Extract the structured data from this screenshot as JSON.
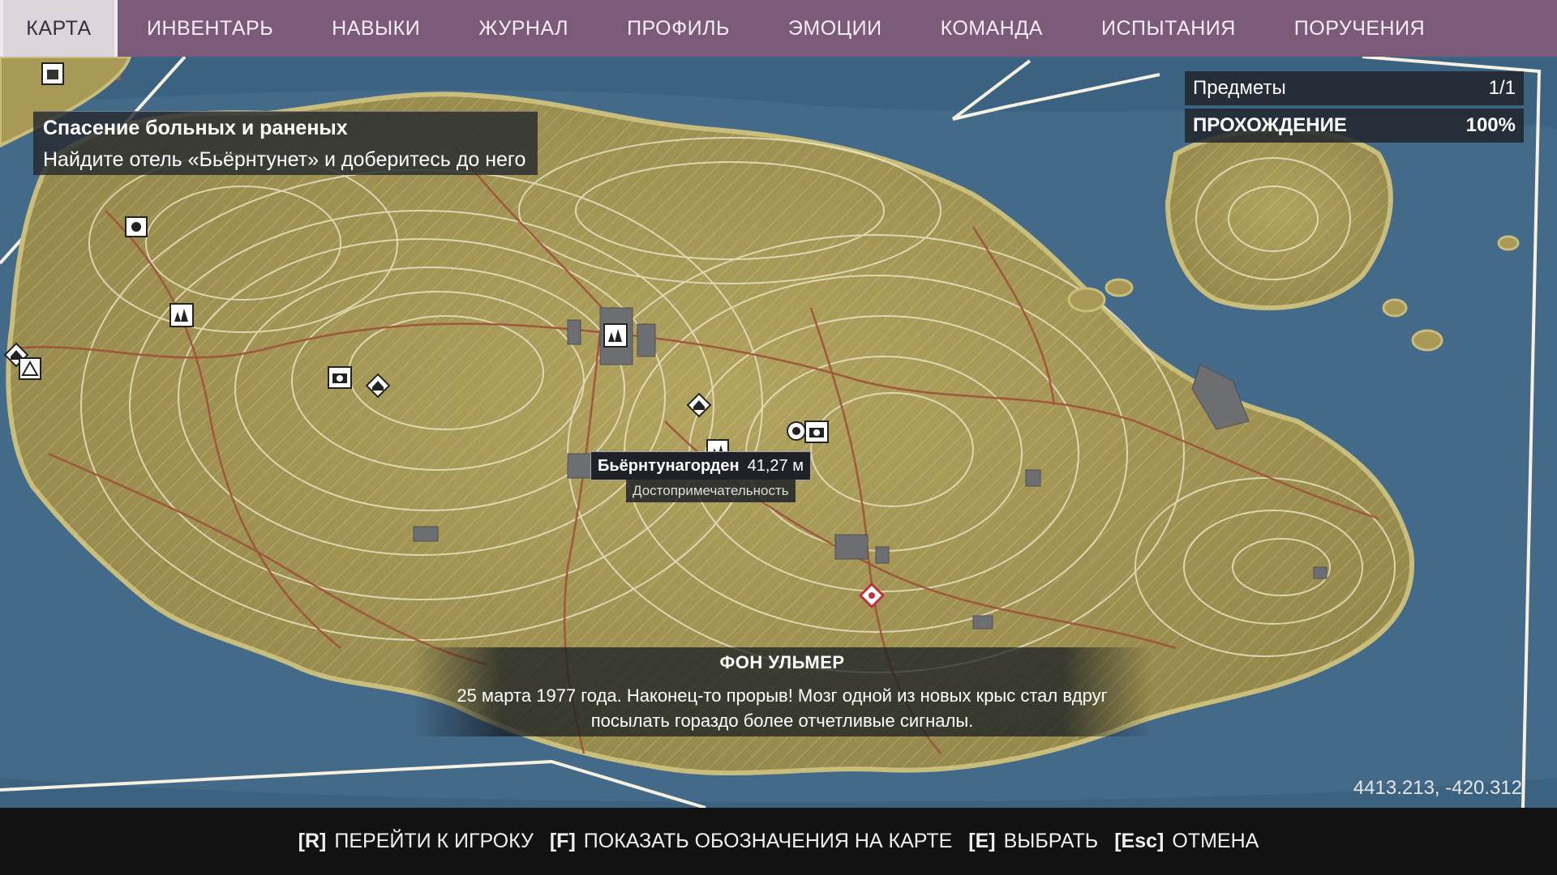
{
  "tabs": [
    {
      "label": "КАРТА",
      "active": true
    },
    {
      "label": "ИНВЕНТАРЬ",
      "active": false
    },
    {
      "label": "НАВЫКИ",
      "active": false
    },
    {
      "label": "ЖУРНАЛ",
      "active": false
    },
    {
      "label": "ПРОФИЛЬ",
      "active": false
    },
    {
      "label": "ЭМОЦИИ",
      "active": false
    },
    {
      "label": "КОМАНДА",
      "active": false
    },
    {
      "label": "ИСПЫТАНИЯ",
      "active": false
    },
    {
      "label": "ПОРУЧЕНИЯ",
      "active": false
    }
  ],
  "objective": {
    "title": "Спасение больных и раненых",
    "description": "Найдите отель «Бьёрнтунет» и доберитесь до него"
  },
  "stats": {
    "items_label": "Предметы",
    "items_value": "1/1",
    "completion_label": "ПРОХОЖДЕНИЕ",
    "completion_value": "100%"
  },
  "tooltip": {
    "name": "Бьёрнтунагорден",
    "distance": "41,27 м",
    "type": "Достопримечательность"
  },
  "subtitle": {
    "speaker": "ФОН УЛЬМЕР",
    "line1": "25 марта 1977 года. Наконец-то прорыв! Мозг одной из новых крыс стал вдруг",
    "line2": "посылать гораздо более отчетливые сигналы."
  },
  "coordinates": "4413.213, -420.312",
  "hints": [
    {
      "key": "[R]",
      "label": "ПЕРЕЙТИ К ИГРОКУ"
    },
    {
      "key": "[F]",
      "label": "ПОКАЗАТЬ ОБОЗНАЧЕНИЯ НА КАРТЕ"
    },
    {
      "key": "[E]",
      "label": "ВЫБРАТЬ"
    },
    {
      "key": "[Esc]",
      "label": "ОТМЕНА"
    }
  ],
  "colors": {
    "tab_bar": "#7c5a7a",
    "active_tab": "#dcd6dc",
    "water": "#3c6282",
    "land": "#a89a56",
    "roads": "#a0503c",
    "contours": "#f0ecd2"
  },
  "map_icons": [
    "building-icon",
    "camera-icon",
    "house-icon",
    "tent-icon",
    "landmark-icon",
    "player-marker-icon",
    "objective-marker-icon"
  ]
}
